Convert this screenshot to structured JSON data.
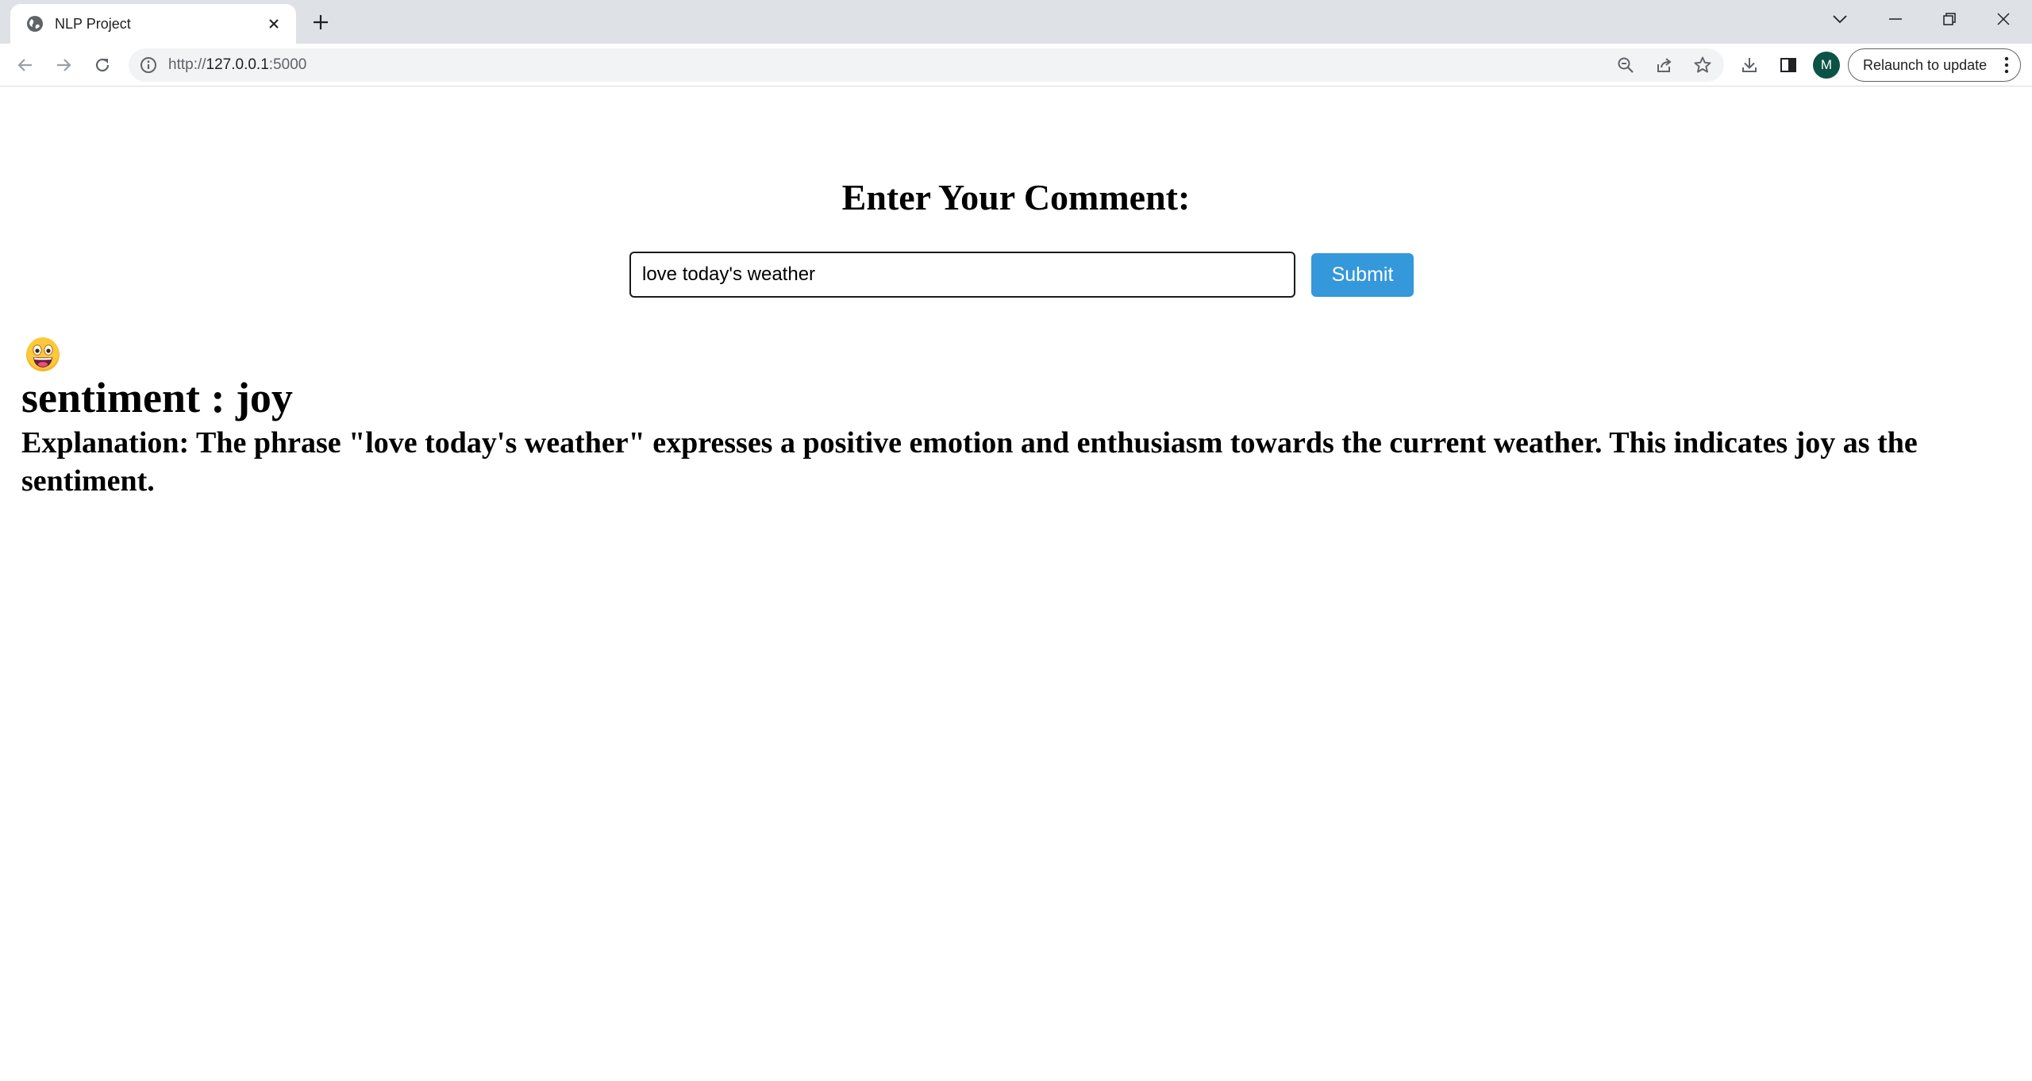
{
  "browser": {
    "tab": {
      "title": "NLP Project"
    },
    "omnibox": {
      "url_protocol": "http://",
      "url_host": "127.0.0.1",
      "url_port": ":5000"
    },
    "profile_initial": "M",
    "relaunch_label": "Relaunch to update"
  },
  "page": {
    "heading": "Enter Your Comment:",
    "comment_input_value": "love today's weather",
    "submit_label": "Submit",
    "result_emoji": "joy-face-emoji",
    "sentiment_text": "sentiment : joy",
    "explanation_text": "Explanation: The phrase \"love today's weather\" expresses a positive emotion and enthusiasm towards the current weather. This indicates joy as the sentiment."
  },
  "colors": {
    "submit_button": "#3498db",
    "avatar": "#0b5345",
    "tabstrip": "#dee1e6"
  }
}
